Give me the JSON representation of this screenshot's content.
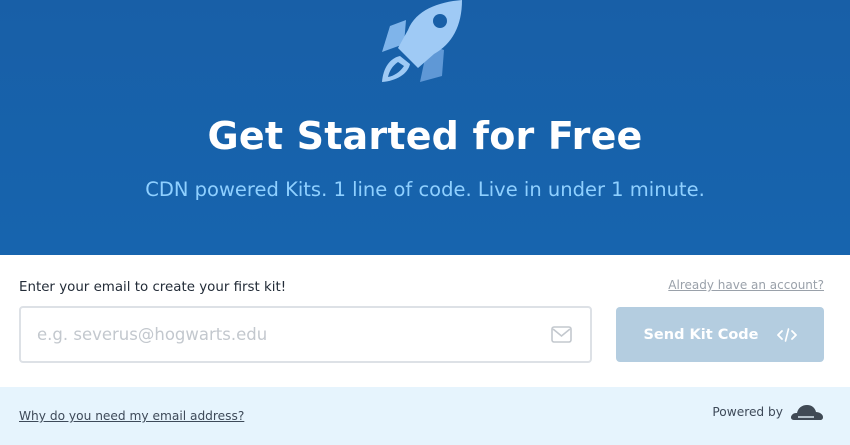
{
  "hero": {
    "title": "Get Started for Free",
    "subtitle": "CDN powered Kits. 1 line of code. Live in under 1 minute.",
    "icon": "rocket-icon"
  },
  "form": {
    "label": "Enter your email to create your first kit!",
    "account_link": "Already have an account?",
    "email": {
      "value": "",
      "placeholder": "e.g. severus@hogwarts.edu",
      "icon": "envelope-icon"
    },
    "submit_label": "Send Kit Code",
    "submit_icon": "code-icon"
  },
  "footer": {
    "why_link": "Why do you need my email address?",
    "powered_by": "Powered by",
    "powered_icon": "cloud-icon"
  },
  "colors": {
    "hero_bg": "#1762ab",
    "subtitle": "#8fd0ff",
    "button_disabled": "#b4cde0",
    "footer_bg": "#e6f4fd"
  }
}
